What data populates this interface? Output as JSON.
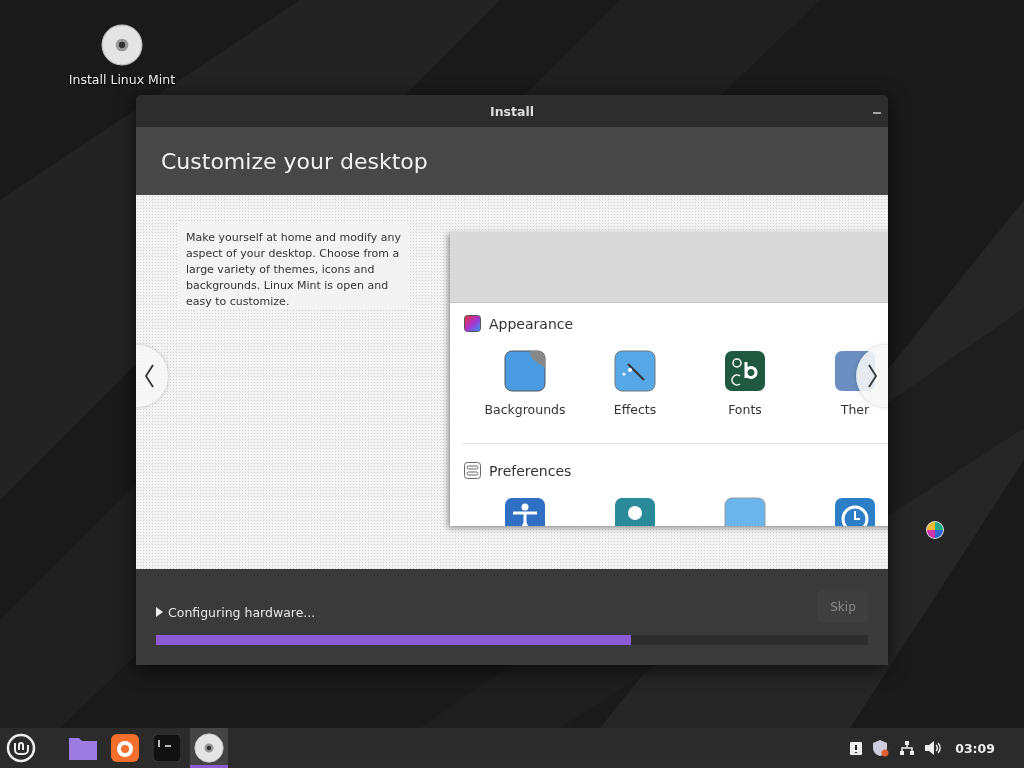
{
  "desktop_icons": [
    {
      "label": "Install Linux Mint"
    }
  ],
  "window": {
    "title": "Install",
    "heading": "Customize your desktop",
    "slide": {
      "description": "Make yourself at home and modify any aspect of your desktop. Choose from a large variety of themes, icons and backgrounds. Linux Mint is open and easy to customize.",
      "sections": [
        {
          "kind": "appearance",
          "title": "Appearance",
          "items": [
            {
              "kind": "backgrounds",
              "label": "Backgrounds"
            },
            {
              "kind": "effects",
              "label": "Effects"
            },
            {
              "kind": "fonts",
              "label": "Fonts"
            },
            {
              "kind": "themes",
              "label": "Ther"
            }
          ]
        },
        {
          "kind": "preferences",
          "title": "Preferences",
          "items": [
            {
              "kind": "accessibility"
            },
            {
              "kind": "account"
            },
            {
              "kind": "blank"
            },
            {
              "kind": "clock"
            }
          ]
        }
      ]
    },
    "status": "Configuring hardware...",
    "progress": {
      "level": 0.667
    },
    "skip": {
      "label": "Skip",
      "disabled": true
    }
  },
  "taskbar": {
    "apps": [
      {
        "kind": "files",
        "selected": false
      },
      {
        "kind": "firefox",
        "selected": false
      },
      {
        "kind": "terminal",
        "selected": false
      },
      {
        "kind": "disc",
        "selected": true
      }
    ],
    "clock": "03:09"
  }
}
